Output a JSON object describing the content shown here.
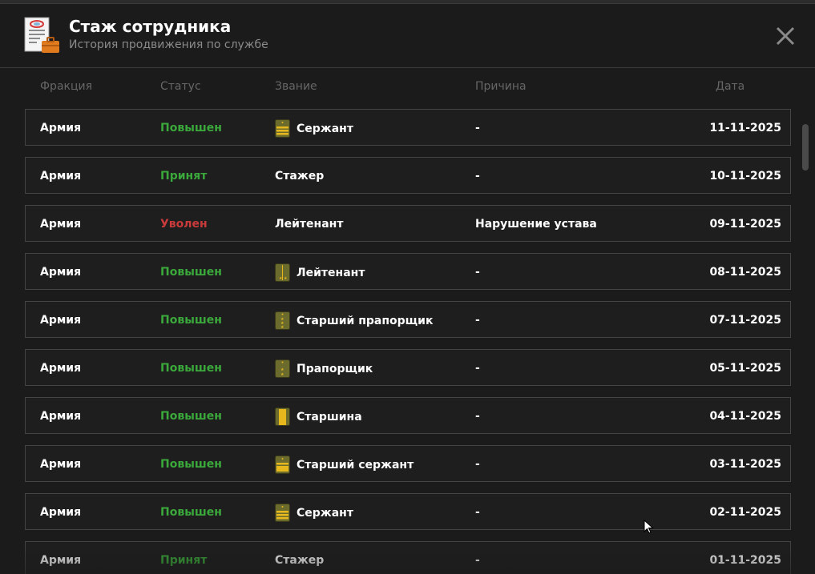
{
  "header": {
    "title": "Стаж сотрудника",
    "subtitle": "История продвижения по службе",
    "icon": "document-briefcase-icon",
    "close_icon": "close-icon"
  },
  "columns": {
    "faction": "Фракция",
    "status": "Статус",
    "rank": "Звание",
    "reason": "Причина",
    "date": "Дата"
  },
  "colors": {
    "status_promoted": "#3aa83a",
    "status_hired": "#3aa83a",
    "status_fired": "#c93b3b",
    "badge_olive": "#6b6b2e",
    "badge_gold": "#e6b81e"
  },
  "rows": [
    {
      "faction": "Армия",
      "status": "Повышен",
      "status_type": "promoted",
      "rank": "Сержант",
      "badge": "sergeant",
      "reason": "-",
      "date": "11-11-2025"
    },
    {
      "faction": "Армия",
      "status": "Принят",
      "status_type": "hired",
      "rank": "Стажер",
      "badge": "",
      "reason": "-",
      "date": "10-11-2025"
    },
    {
      "faction": "Армия",
      "status": "Уволен",
      "status_type": "fired",
      "rank": "Лейтенант",
      "badge": "",
      "reason": "Нарушение устава",
      "date": "09-11-2025"
    },
    {
      "faction": "Армия",
      "status": "Повышен",
      "status_type": "promoted",
      "rank": "Лейтенант",
      "badge": "lieutenant",
      "reason": "-",
      "date": "08-11-2025"
    },
    {
      "faction": "Армия",
      "status": "Повышен",
      "status_type": "promoted",
      "rank": "Старший прапорщик",
      "badge": "senior-warrant",
      "reason": "-",
      "date": "07-11-2025"
    },
    {
      "faction": "Армия",
      "status": "Повышен",
      "status_type": "promoted",
      "rank": "Прапорщик",
      "badge": "warrant",
      "reason": "-",
      "date": "05-11-2025"
    },
    {
      "faction": "Армия",
      "status": "Повышен",
      "status_type": "promoted",
      "rank": "Старшина",
      "badge": "starshina",
      "reason": "-",
      "date": "04-11-2025"
    },
    {
      "faction": "Армия",
      "status": "Повышен",
      "status_type": "promoted",
      "rank": "Старший сержант",
      "badge": "senior-sergeant",
      "reason": "-",
      "date": "03-11-2025"
    },
    {
      "faction": "Армия",
      "status": "Повышен",
      "status_type": "promoted",
      "rank": "Сержант",
      "badge": "sergeant",
      "reason": "-",
      "date": "02-11-2025"
    },
    {
      "faction": "Армия",
      "status": "Принят",
      "status_type": "hired",
      "rank": "Стажер",
      "badge": "",
      "reason": "-",
      "date": "01-11-2025"
    }
  ]
}
